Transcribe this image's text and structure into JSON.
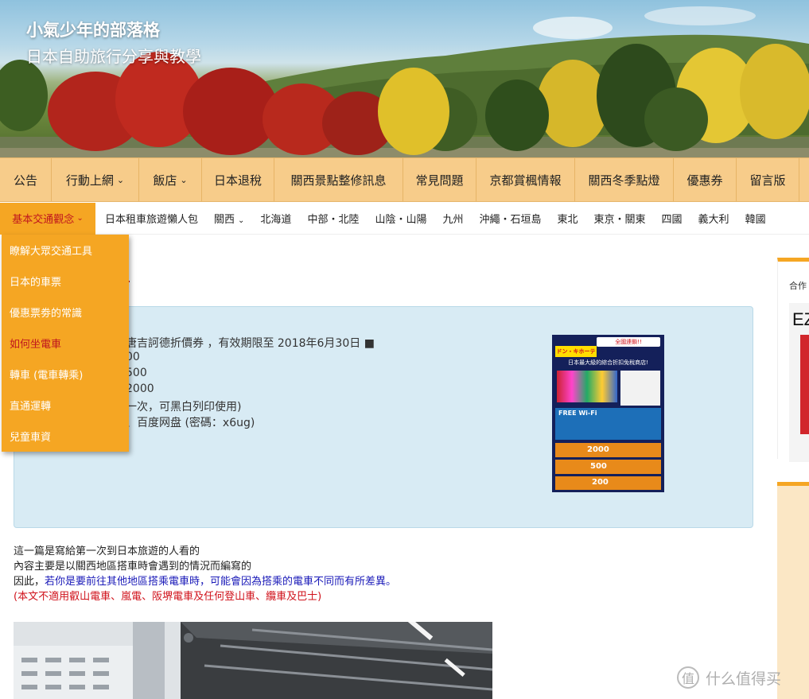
{
  "site": {
    "title": "小氣少年的部落格",
    "subtitle": "日本自助旅行分享與教學"
  },
  "primary_nav": [
    {
      "label": "公告",
      "dropdown": false
    },
    {
      "label": "行動上網",
      "dropdown": true
    },
    {
      "label": "飯店",
      "dropdown": true
    },
    {
      "label": "日本退稅",
      "dropdown": false
    },
    {
      "label": "關西景點整修訊息",
      "dropdown": false
    },
    {
      "label": "常見問題",
      "dropdown": false
    },
    {
      "label": "京都賞楓情報",
      "dropdown": false
    },
    {
      "label": "關西冬季點燈",
      "dropdown": false
    },
    {
      "label": "優惠券",
      "dropdown": false
    },
    {
      "label": "留言版",
      "dropdown": false
    }
  ],
  "secondary_nav": {
    "active": "基本交通觀念",
    "items": [
      "日本租車旅遊懶人包",
      "關西",
      "北海道",
      "中部・北陸",
      "山陰・山陽",
      "九州",
      "沖繩・石垣島",
      "東北",
      "東京・關東",
      "四國",
      "義大利",
      "韓國"
    ]
  },
  "dropdown": {
    "items": [
      "瞭解大眾交通工具",
      "日本的車票",
      "優惠票劵的常識",
      "如何坐電車",
      "轉車 (電車轉乘)",
      "直通運轉",
      "兒童車資"
    ],
    "active_index": 3
  },
  "info_box": {
    "line1": "唐吉訶德折價券 ，有效期限至 2018年6月30日 ■",
    "line2": "00",
    "line3": "500",
    "line4": "2000",
    "line5": "一次，可黑白列印使用)",
    "line6": "、百度网盘 (密碼：x6ug)",
    "coupon": {
      "top_badge": "全國連鎖!!",
      "brand": "ドン・キホーテ",
      "headline": "日本最大級的綜合折扣免稅商店!",
      "wifi": "FREE Wi-Fi",
      "amounts": [
        "2000",
        "500",
        "200"
      ]
    }
  },
  "intro": {
    "line1": "這一篇是寫給第一次到日本旅遊的人看的",
    "line2": "內容主要是以關西地區搭車時會遇到的情況而編寫的",
    "line3_prefix": "因此，",
    "line3_blue": "若你是要前往其他地區搭乘電車時，可能會因為搭乘的電車不同而有所差異。",
    "line4": "(本文不適用叡山電車、嵐電、阪堺電車及任何登山車、纜車及巴士)"
  },
  "sidebar": {
    "widget1_label": "合作",
    "widget1_card_text": "EZ"
  },
  "watermark": {
    "logo": "值",
    "text": "什么值得买"
  },
  "colors": {
    "nav_primary": "#f7cc8a",
    "accent_orange": "#f5a623",
    "active_red": "#c0161e",
    "info_box_bg": "#d8ebf4",
    "intro_blue": "#1a1ab8",
    "intro_red": "#d0121b"
  }
}
